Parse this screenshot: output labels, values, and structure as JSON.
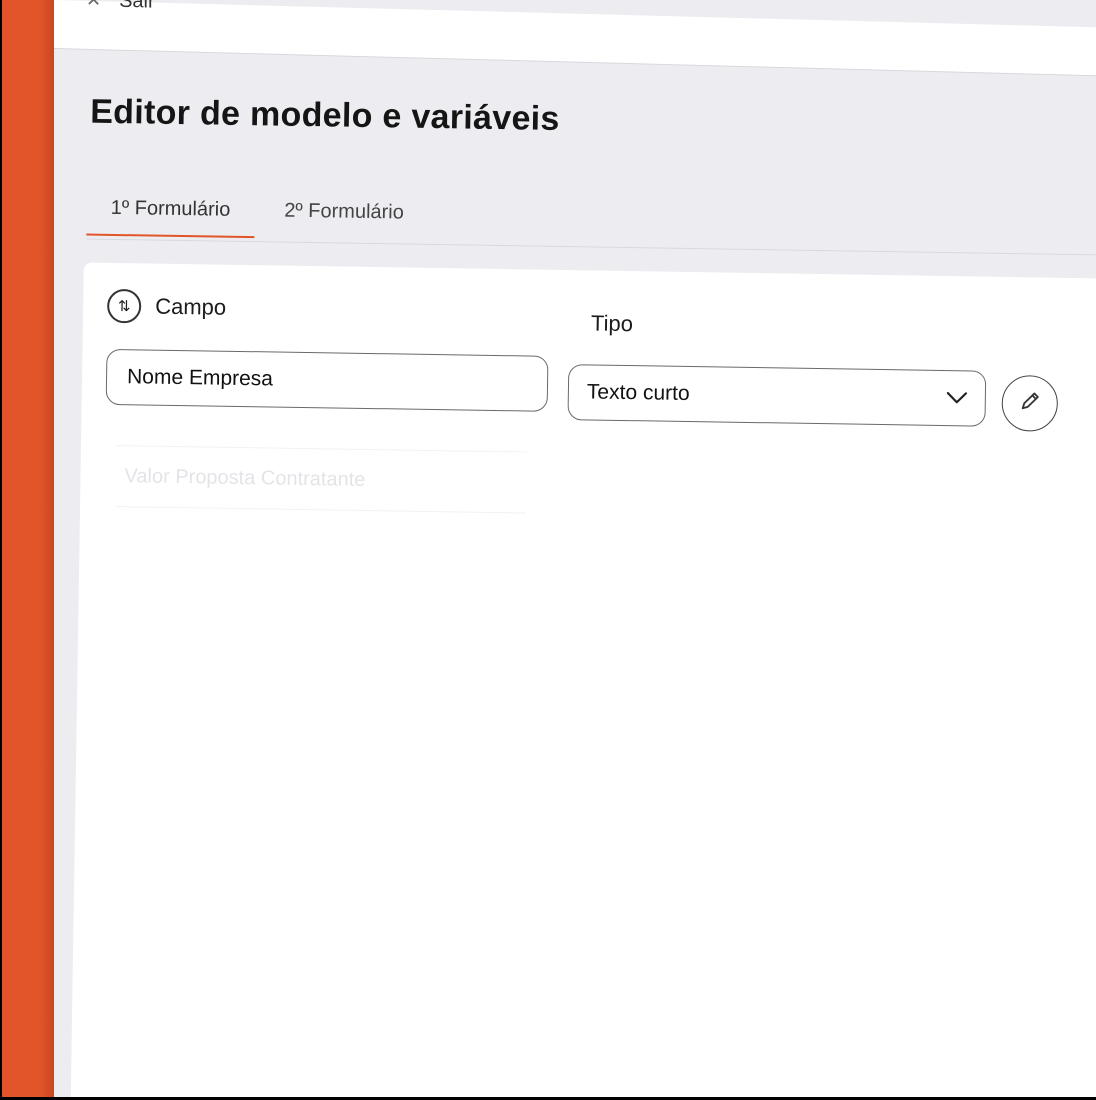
{
  "topbar": {
    "exit_label": "Sair"
  },
  "page": {
    "title": "Editor de modelo e variáveis"
  },
  "tabs": [
    {
      "label": "1º Formulário",
      "active": true
    },
    {
      "label": "2º Formulário",
      "active": false
    }
  ],
  "form": {
    "field_header": "Campo",
    "type_header": "Tipo",
    "rows": [
      {
        "field_value": "Nome Empresa",
        "type_value": "Texto curto"
      }
    ],
    "ghost_row": "Valor Proposta Contratante"
  },
  "icons": {
    "close": "close-icon",
    "sort": "sort-icon",
    "chevron": "chevron-down-icon",
    "edit": "pencil-icon"
  },
  "colors": {
    "accent": "#e2542a",
    "panel_bg": "#ededf1",
    "card_bg": "#ffffff"
  }
}
